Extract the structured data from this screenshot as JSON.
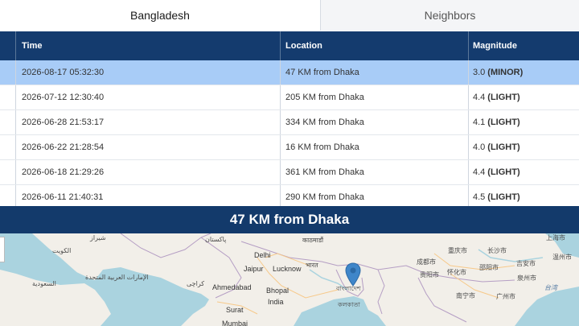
{
  "tabs": [
    {
      "label": "Bangladesh",
      "active": true
    },
    {
      "label": "Neighbors",
      "active": false
    }
  ],
  "table": {
    "headers": [
      "Time",
      "Location",
      "Magnitude"
    ],
    "rows": [
      {
        "time": "2026-08-17 05:32:30",
        "location": "47 KM from Dhaka",
        "mag": "3.0",
        "class": "(MINOR)",
        "selected": true
      },
      {
        "time": "2026-07-12 12:30:40",
        "location": "205 KM from Dhaka",
        "mag": "4.4",
        "class": "(LIGHT)"
      },
      {
        "time": "2026-06-28 21:53:17",
        "location": "334 KM from Dhaka",
        "mag": "4.1",
        "class": "(LIGHT)"
      },
      {
        "time": "2026-06-22 21:28:54",
        "location": "16 KM from Dhaka",
        "mag": "4.0",
        "class": "(LIGHT)"
      },
      {
        "time": "2026-06-18 21:29:26",
        "location": "361 KM from Dhaka",
        "mag": "4.4",
        "class": "(LIGHT)"
      },
      {
        "time": "2026-06-11 21:40:31",
        "location": "290 KM from Dhaka",
        "mag": "4.5",
        "class": "(LIGHT)"
      }
    ]
  },
  "banner": {
    "title": "47 KM from Dhaka"
  },
  "map": {
    "labels": {
      "shiraz": "شیراز",
      "pakistan": "پاکستان",
      "kathmandu": "काठमाडौं",
      "kuwait": "الكويت",
      "delhi": "Delhi",
      "jaipur": "Jaipur",
      "lucknow": "Lucknow",
      "bharat": "भारत",
      "emirates": "الإمارات العربية المتحدة",
      "saudi": "السعودية",
      "karachi": "کراچی",
      "ahmedabad": "Ahmedabad",
      "bhopal": "Bhopal",
      "india": "India",
      "surat": "Surat",
      "mumbai": "Mumbai",
      "bangladesh": "বাংলাদেশ",
      "kolkata": "কলকাতা",
      "shanghai": "上海市",
      "chongqing": "重庆市",
      "changsha": "长沙市",
      "wenzhou": "温州市",
      "chengdu": "成都市",
      "guiyang": "贵阳市",
      "zhaoyang": "邵阳市",
      "jian": "吉安市",
      "quanzhou": "泉州市",
      "huaihua": "怀化市",
      "nanning": "南宁市",
      "guangzhou": "广州市",
      "taiwan": "台湾"
    },
    "marker_color": "#3f86c9"
  },
  "colors": {
    "header_bg": "#143b6e",
    "selected_row": "#a8ccf7",
    "banner_bg": "#133a6b"
  }
}
